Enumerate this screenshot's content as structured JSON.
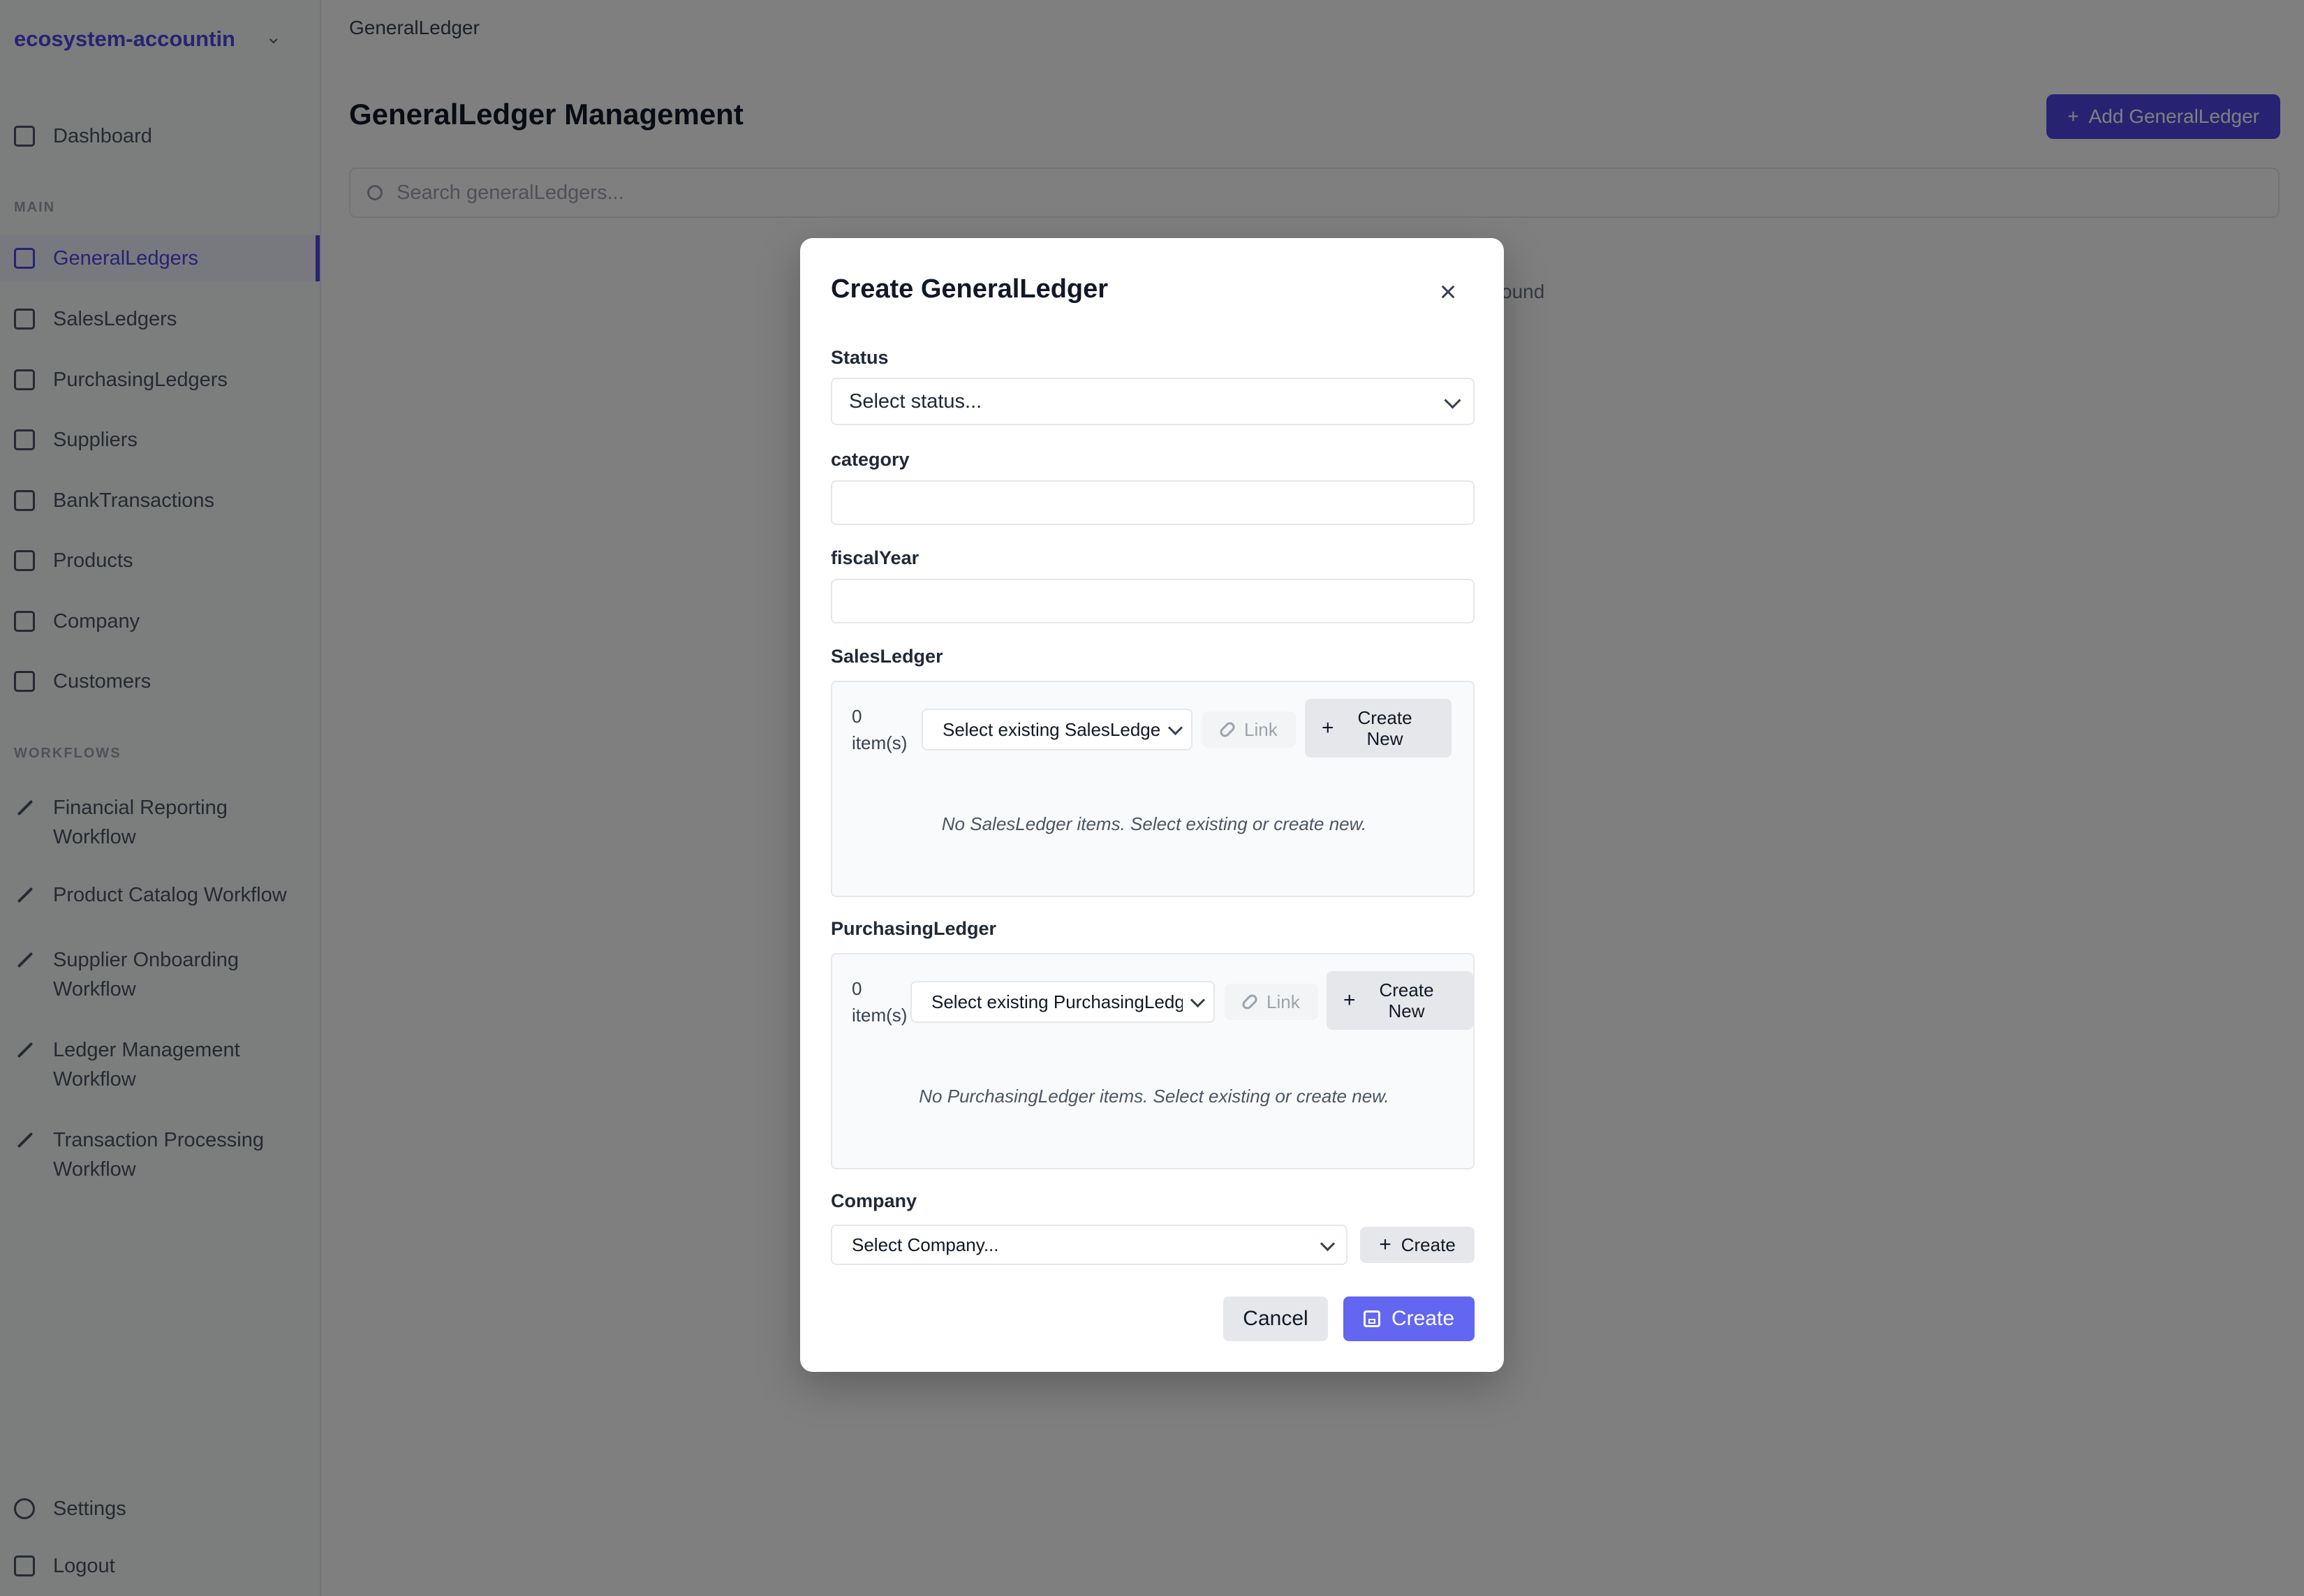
{
  "app": {
    "brand": "ecosystem-accountin",
    "nav_dashboard": "Dashboard",
    "section_main": "MAIN",
    "nav_items": [
      "GeneralLedgers",
      "SalesLedgers",
      "PurchasingLedgers",
      "Suppliers",
      "BankTransactions",
      "Products",
      "Company",
      "Customers"
    ],
    "section_workflows": "WORKFLOWS",
    "workflows": [
      [
        "Financial Reporting",
        "Workflow"
      ],
      [
        "Product Catalog Workflow"
      ],
      [
        "Supplier Onboarding",
        "Workflow"
      ],
      [
        "Ledger Management",
        "Workflow"
      ],
      [
        "Transaction Processing",
        "Workflow"
      ]
    ],
    "settings": "Settings",
    "logout": "Logout",
    "breadcrumb": "GeneralLedger",
    "page_title": "GeneralLedger Management",
    "add_button": "Add GeneralLedger",
    "search_placeholder": "Search generalLedgers...",
    "bg_empty_text": "ound"
  },
  "modal": {
    "title": "Create GeneralLedger",
    "status_label": "Status",
    "status_placeholder": "Select status...",
    "category_label": "category",
    "category_value": "",
    "fiscal_year_label": "fiscalYear",
    "fiscal_year_value": "",
    "sales_ledger": {
      "label": "SalesLedger",
      "count_line1": "0",
      "count_line2": "item(s)",
      "select_placeholder": "Select existing SalesLedge",
      "link_label": "Link",
      "create_new_line1": "Create",
      "create_new_line2": "New",
      "empty_message": "No SalesLedger items. Select existing or create new."
    },
    "purchasing_ledger": {
      "label": "PurchasingLedger",
      "count_line1": "0",
      "count_line2": "item(s)",
      "select_placeholder": "Select existing PurchasingLedg",
      "link_label": "Link",
      "create_new_line1": "Create",
      "create_new_line2": "New",
      "empty_message": "No PurchasingLedger items. Select existing or create new."
    },
    "company_label": "Company",
    "company_placeholder": "Select Company...",
    "company_create": "Create",
    "cancel": "Cancel",
    "submit": "Create"
  },
  "icons": {
    "close": "close-icon",
    "chevron": "chevron-down-icon",
    "plus": "plus-icon",
    "link": "link-icon",
    "save": "save-icon"
  },
  "colors": {
    "accent": "#6366f1",
    "brand": "#4f46e5",
    "overlay": "rgba(0,0,0,0.5)"
  }
}
